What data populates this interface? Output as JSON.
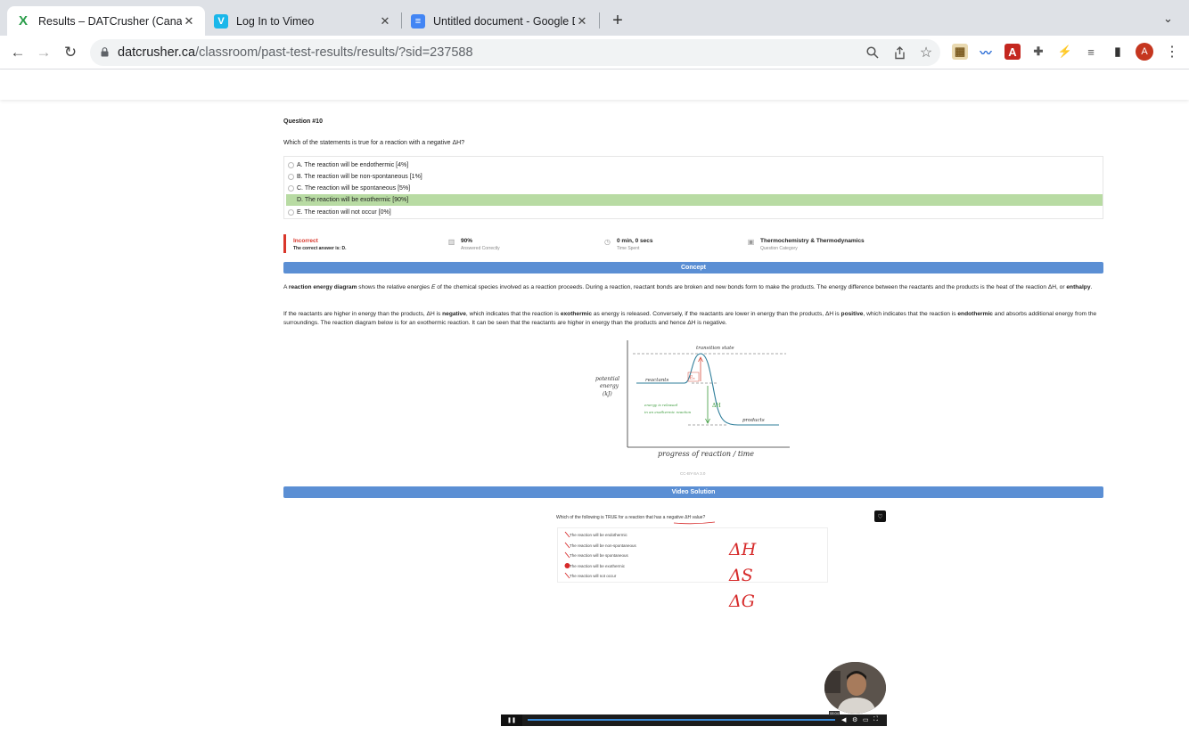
{
  "browser": {
    "tabs": [
      {
        "title": "Results – DATCrusher (Canadian",
        "favicon": "X",
        "active": true
      },
      {
        "title": "Log In to Vimeo",
        "favicon": "V",
        "active": false
      },
      {
        "title": "Untitled document - Google Docs",
        "favicon": "≡",
        "active": false
      }
    ],
    "url_host": "datcrusher.ca",
    "url_path": "/classroom/past-test-results/results/?sid=237588",
    "profile_initial": "A"
  },
  "question": {
    "number_label": "Question #10",
    "text": "Which of the statements is true for a reaction with a negative ΔH?",
    "choices": [
      {
        "label": "A. The reaction will be endothermic [4%]",
        "correct": false
      },
      {
        "label": "B. The reaction will be non-spontaneous [1%]",
        "correct": false
      },
      {
        "label": "C. The reaction will be spontaneous [5%]",
        "correct": false
      },
      {
        "label": "D. The reaction will be exothermic [90%]",
        "correct": true
      },
      {
        "label": "E. The reaction will not occur [0%]",
        "correct": false
      }
    ]
  },
  "result": {
    "status": "Incorrect",
    "correct_answer": "The correct answer is: D.",
    "percent_correct": "90%",
    "percent_correct_label": "Answered Correctly",
    "time_spent": "0 min, 0 secs",
    "time_spent_label": "Time Spent",
    "category": "Thermochemistry & Thermodynamics",
    "category_label": "Question Category"
  },
  "concept": {
    "heading": "Concept",
    "p1": [
      {
        "t": "A ",
        "b": false
      },
      {
        "t": "reaction energy diagram",
        "b": true
      },
      {
        "t": " shows the relative energies ",
        "b": false
      },
      {
        "t": "E",
        "b": false,
        "i": true
      },
      {
        "t": " of the chemical species involved as a reaction proceeds. During a reaction, reactant bonds are broken and new bonds form to make the products. The energy difference between the reactants and the products is the heat of the reaction ΔH, or ",
        "b": false
      },
      {
        "t": "enthalpy",
        "b": true
      },
      {
        "t": ".",
        "b": false
      }
    ],
    "p2": [
      {
        "t": "If the reactants are higher in energy than the products, ΔH is ",
        "b": false
      },
      {
        "t": "negative",
        "b": true
      },
      {
        "t": ", which indicates that the reaction is ",
        "b": false
      },
      {
        "t": "exothermic",
        "b": true
      },
      {
        "t": " as energy is released. Conversely, if the reactants are lower in energy than the products, ΔH is ",
        "b": false
      },
      {
        "t": "positive",
        "b": true
      },
      {
        "t": ", which indicates that the reaction is ",
        "b": false
      },
      {
        "t": "endothermic",
        "b": true
      },
      {
        "t": " and absorbs additional energy from the surroundings. The reaction diagram below is for an exothermic reaction. It can be seen that the reactants are higher in energy than the products and hence ΔH is negative.",
        "b": false
      }
    ],
    "diagram": {
      "transition_label": "transition state",
      "reactants_label": "reactants",
      "products_label": "products",
      "ea_label": "Eₐ",
      "dh_label": "ΔH",
      "released_label_1": "energy is released",
      "released_label_2": "in an exothermic reaction",
      "y_label_1": "potential",
      "y_label_2": "energy",
      "y_label_3": "(kJ)",
      "x_label": "progress of reaction / time"
    },
    "credit": "CC-BY-SA 3.0"
  },
  "video": {
    "heading": "Video Solution",
    "question": "Which of the following is TRUE for a reaction that has a negative ΔH value?",
    "items": [
      "The reaction will be endothermic",
      "The reaction will be non-spontaneous",
      "The reaction will be spontaneous",
      "The reaction will be exothermic",
      "The reaction will not occur"
    ],
    "handwriting": [
      "ΔH",
      "ΔS",
      "ΔG"
    ],
    "time_badge": "08:04"
  },
  "colors": {
    "accent": "#5b8fd4",
    "correct": "#b8dba3",
    "incorrect": "#d9362b"
  }
}
